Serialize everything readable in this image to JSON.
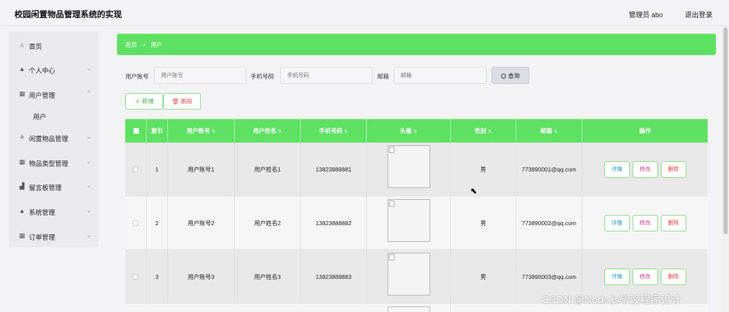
{
  "header": {
    "title": "校园闲置物品管理系统的实现",
    "user": "管理员 abo",
    "logout": "退出登录"
  },
  "sidebar": {
    "items": [
      {
        "icon": "home-icon",
        "glyph": "⌂",
        "label": "首页"
      },
      {
        "icon": "person-icon",
        "glyph": "▲",
        "label": "个人中心"
      },
      {
        "icon": "grid-icon",
        "glyph": "▦",
        "label": "用户管理"
      },
      {
        "icon": "list-icon",
        "glyph": "≡",
        "label": "闲置物品管理"
      },
      {
        "icon": "grid-icon",
        "glyph": "▦",
        "label": "物品类型管理"
      },
      {
        "icon": "chart-icon",
        "glyph": "▟",
        "label": "留言板管理"
      },
      {
        "icon": "person-icon",
        "glyph": "▲",
        "label": "系统管理"
      },
      {
        "icon": "grid-icon",
        "glyph": "▦",
        "label": "订单管理"
      }
    ],
    "subitem": "用户"
  },
  "breadcrumb": {
    "home": "首页",
    "arrow": "→",
    "current": "用户"
  },
  "search": {
    "account_label": "用户账号",
    "account_placeholder": "用户账号",
    "phone_label": "手机号码",
    "phone_placeholder": "手机号码",
    "email_label": "邮箱",
    "email_placeholder": "邮箱",
    "button": "查询"
  },
  "actions": {
    "add": "＋ 新增",
    "delete": "🗑 删除"
  },
  "table": {
    "columns": [
      "索引",
      "用户账号",
      "用户姓名",
      "手机号码",
      "头像",
      "性别",
      "邮箱",
      "操作"
    ],
    "rows": [
      {
        "index": "1",
        "account": "用户账号1",
        "name": "用户姓名1",
        "phone": "13823888881",
        "gender": "男",
        "email": "773890001@qq.com"
      },
      {
        "index": "2",
        "account": "用户账号2",
        "name": "用户姓名2",
        "phone": "13823888882",
        "gender": "男",
        "email": "773890002@qq.com"
      },
      {
        "index": "3",
        "account": "用户账号3",
        "name": "用户姓名3",
        "phone": "13823888883",
        "gender": "男",
        "email": "773890003@qq.com"
      }
    ],
    "ops": {
      "detail": "详情",
      "edit": "修改",
      "remove": "删除"
    }
  },
  "watermark": "CSDN @Node.js毕设程序设计",
  "colors": {
    "accent": "#5ee063",
    "background": "#f3f3f6"
  }
}
